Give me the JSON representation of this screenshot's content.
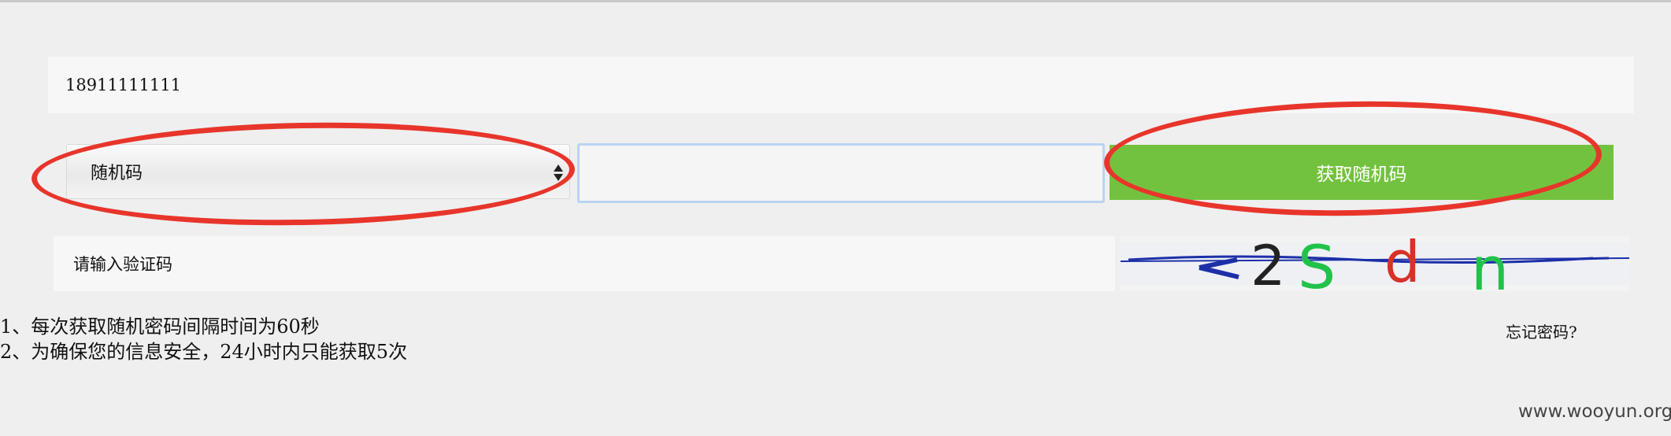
{
  "form": {
    "phone_value": "18911111111",
    "code_type": {
      "selected": "随机码"
    },
    "code_input_value": "",
    "get_code_label": "获取随机码",
    "captcha_placeholder": "请输入验证码",
    "captcha_text": "2Sdn"
  },
  "notes": [
    "1、每次获取随机密码间隔时间为60秒",
    "2、为确保您的信息安全，24小时内只能获取5次"
  ],
  "forgot_password_label": "忘记密码?",
  "watermark": "www.wooyun.org",
  "colors": {
    "button_green": "#73c23f",
    "annotation_red": "#e8352b",
    "input_focus_border": "#b9d4f2"
  },
  "icons": {
    "select_arrows": "updown-arrows-icon"
  }
}
